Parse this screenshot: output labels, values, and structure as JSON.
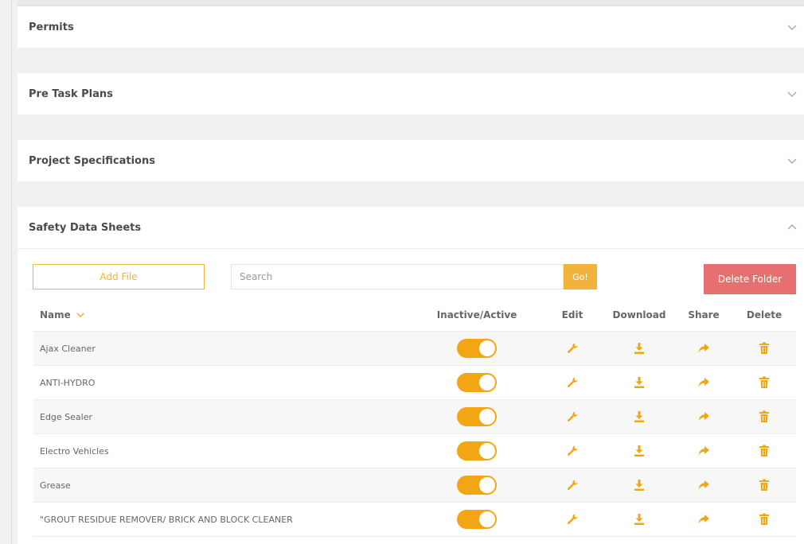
{
  "panels": [
    {
      "title": "Permits",
      "expanded": false
    },
    {
      "title": "Pre Task Plans",
      "expanded": false
    },
    {
      "title": "Project Specifications",
      "expanded": false
    },
    {
      "title": "Safety Data Sheets",
      "expanded": true
    }
  ],
  "toolbar": {
    "add_file_label": "Add File",
    "search_placeholder": "Search",
    "go_label": "Go!",
    "delete_folder_label": "Delete Folder"
  },
  "table": {
    "headers": {
      "name": "Name",
      "active": "Inactive/Active",
      "edit": "Edit",
      "download": "Download",
      "share": "Share",
      "delete": "Delete"
    },
    "rows": [
      {
        "name": "Ajax Cleaner",
        "active": true
      },
      {
        "name": "ANTI-HYDRO",
        "active": true
      },
      {
        "name": "Edge Sealer",
        "active": true
      },
      {
        "name": "Electro Vehicles",
        "active": true
      },
      {
        "name": "Grease",
        "active": true
      },
      {
        "name": "\"GROUT RESIDUE REMOVER/ BRICK AND BLOCK CLEANER",
        "active": true
      }
    ]
  },
  "colors": {
    "accent": "#f2b33d",
    "toggle_on": "#f2a614",
    "danger": "#e5706f"
  },
  "icons": {
    "edit": "wrench-icon",
    "download": "download-icon",
    "share": "share-icon",
    "delete": "trash-icon",
    "collapse": "chevron-down-icon",
    "expand": "chevron-up-icon",
    "sort": "sort-chevron-icon"
  }
}
